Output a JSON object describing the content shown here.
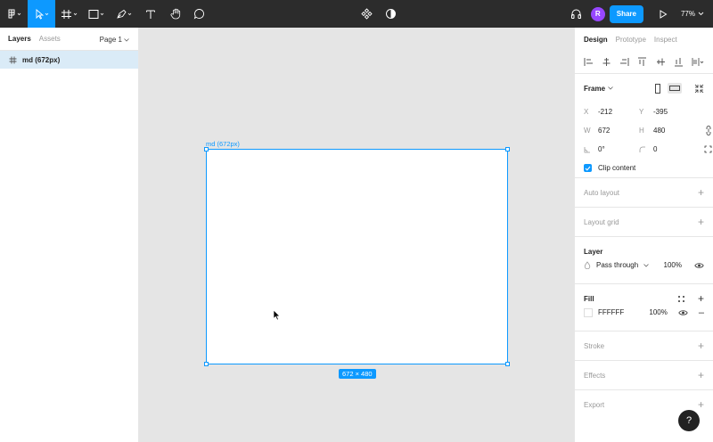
{
  "toolbar": {
    "share_label": "Share",
    "avatar_initial": "R",
    "zoom": "77%"
  },
  "left_panel": {
    "tabs": [
      "Layers",
      "Assets"
    ],
    "page_select": "Page 1",
    "layers": [
      {
        "name": "md (672px)"
      }
    ]
  },
  "canvas": {
    "frame_label": "md (672px)",
    "size_badge": "672 × 480"
  },
  "right_panel": {
    "tabs": [
      "Design",
      "Prototype",
      "Inspect"
    ],
    "frame": {
      "title": "Frame",
      "x_label": "X",
      "x": "-212",
      "y_label": "Y",
      "y": "-395",
      "w_label": "W",
      "w": "672",
      "h_label": "H",
      "h": "480",
      "rotation": "0°",
      "radius": "0",
      "clip_content": "Clip content"
    },
    "auto_layout": "Auto layout",
    "layout_grid": "Layout grid",
    "layer": {
      "title": "Layer",
      "blend": "Pass through",
      "opacity": "100%"
    },
    "fill": {
      "title": "Fill",
      "hex": "FFFFFF",
      "opacity": "100%",
      "color": "#FFFFFF"
    },
    "stroke": "Stroke",
    "effects": "Effects",
    "export": "Export"
  },
  "help_label": "?",
  "colors": {
    "accent": "#0d99ff",
    "toolbar_bg": "#2c2c2c",
    "avatar": "#9747ff"
  }
}
